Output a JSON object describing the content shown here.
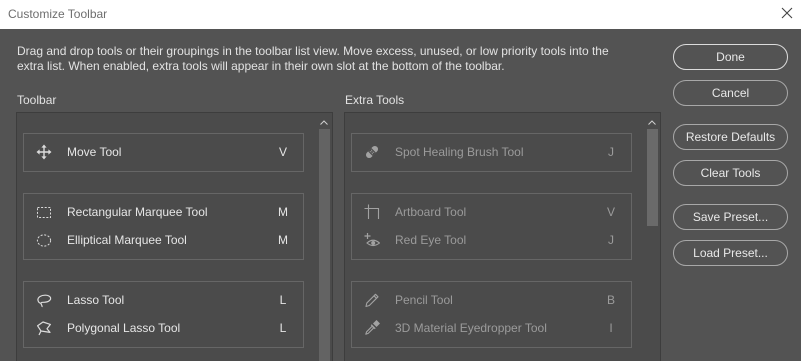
{
  "window": {
    "title": "Customize Toolbar",
    "close_icon": "close-icon"
  },
  "instructions": {
    "line1": "Drag and drop tools or their groupings in the toolbar list view. Move excess, unused, or low priority tools into the",
    "line2": "extra list. When enabled, extra tools will appear in their own slot at the bottom of the toolbar."
  },
  "toolbar_list": {
    "label": "Toolbar",
    "scroll_icon": "chevron-up-icon",
    "groups": [
      {
        "tools": [
          {
            "name": "Move Tool",
            "shortcut": "V",
            "icon": "move-icon"
          }
        ]
      },
      {
        "tools": [
          {
            "name": "Rectangular Marquee Tool",
            "shortcut": "M",
            "icon": "rectangular-marquee-icon"
          },
          {
            "name": "Elliptical Marquee Tool",
            "shortcut": "M",
            "icon": "elliptical-marquee-icon"
          }
        ]
      },
      {
        "tools": [
          {
            "name": "Lasso Tool",
            "shortcut": "L",
            "icon": "lasso-icon"
          },
          {
            "name": "Polygonal Lasso Tool",
            "shortcut": "L",
            "icon": "polygonal-lasso-icon"
          }
        ]
      }
    ]
  },
  "extra_tools_list": {
    "label": "Extra Tools",
    "scroll_icon": "chevron-up-icon",
    "groups": [
      {
        "tools": [
          {
            "name": "Spot Healing Brush Tool",
            "shortcut": "J",
            "icon": "spot-healing-brush-icon"
          }
        ]
      },
      {
        "tools": [
          {
            "name": "Artboard Tool",
            "shortcut": "V",
            "icon": "artboard-icon"
          },
          {
            "name": "Red Eye Tool",
            "shortcut": "J",
            "icon": "red-eye-icon"
          }
        ]
      },
      {
        "tools": [
          {
            "name": "Pencil Tool",
            "shortcut": "B",
            "icon": "pencil-icon"
          },
          {
            "name": "3D Material Eyedropper Tool",
            "shortcut": "I",
            "icon": "3d-material-eyedropper-icon"
          }
        ]
      }
    ]
  },
  "buttons": {
    "done": "Done",
    "cancel": "Cancel",
    "restore_defaults": "Restore Defaults",
    "clear_tools": "Clear Tools",
    "save_preset": "Save Preset...",
    "load_preset": "Load Preset..."
  },
  "colors": {
    "title_bar": "#ffffff",
    "dialog_background": "#535353",
    "list_background": "#4b4b4b",
    "text": "#e4e4e4",
    "extra_tool_text": "#9b9b9b"
  }
}
